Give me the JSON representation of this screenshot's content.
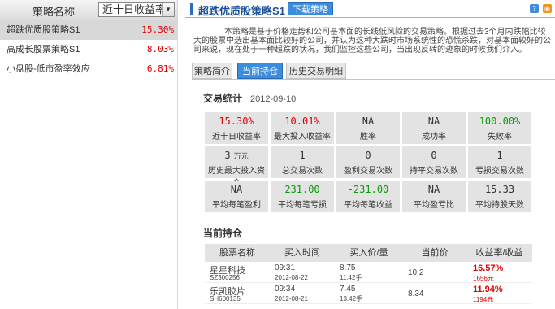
{
  "sidebar": {
    "header_name": "策略名称",
    "sort_select": "近十日收益率",
    "items": [
      {
        "label": "超跌优质股策略S1",
        "value": "15.30%"
      },
      {
        "label": "高成长股票策略S1",
        "value": "8.03%"
      },
      {
        "label": "小盘股-低市盈率效应",
        "value": "6.81%"
      }
    ]
  },
  "header": {
    "title": "超跌优质股策略S1",
    "download_label": "下载策略",
    "help_icon": "help-icon",
    "rss_icon": "rss-icon"
  },
  "description": "本策略是基于价格走势和公司基本面的长线低风险的交易策略。根据过去3个月内跌幅比较大的股票中选出基本面比较好的公司，并认为这种大跌时市场系统性的恐慌杀跌，对基本面较好的公司来说，现在处于一种超跌的状况，我们监控这些公司，当出现反转的迹象的时候我们介入。",
  "tabs": [
    "策略简介",
    "当前持仓",
    "历史交易明细"
  ],
  "stats": {
    "title": "交易统计",
    "date": "2012-09-10",
    "cells": [
      {
        "value": "15.30%",
        "label": "近十日收益率",
        "color": "red"
      },
      {
        "value": "10.01%",
        "label": "最大投入收益率",
        "color": "red"
      },
      {
        "value": "NA",
        "label": "胜率",
        "color": "black"
      },
      {
        "value": "NA",
        "label": "成功率",
        "color": "black"
      },
      {
        "value": "100.00%",
        "label": "失败率",
        "color": "green"
      },
      {
        "value": "3",
        "unit": "万元",
        "label": "历史最大投入资金",
        "color": "black"
      },
      {
        "value": "1",
        "label": "总交易次数",
        "color": "black"
      },
      {
        "value": "0",
        "label": "盈利交易次数",
        "color": "black"
      },
      {
        "value": "0",
        "label": "持平交易次数",
        "color": "black"
      },
      {
        "value": "1",
        "label": "亏损交易次数",
        "color": "black"
      },
      {
        "value": "NA",
        "label": "平均每笔盈利",
        "color": "black"
      },
      {
        "value": "231.00",
        "label": "平均每笔亏损",
        "color": "green"
      },
      {
        "value": "-231.00",
        "label": "平均每笔收益",
        "color": "green"
      },
      {
        "value": "NA",
        "label": "平均盈亏比",
        "color": "black"
      },
      {
        "value": "15.33",
        "label": "平均持股天数",
        "color": "black"
      }
    ]
  },
  "holdings": {
    "title": "当前持仓",
    "columns": [
      "股票名称",
      "买入时间",
      "买入价/量",
      "当前价",
      "收益率/收益"
    ],
    "rows": [
      {
        "name": "星星科技",
        "code": "SZ300256",
        "time": "09:31",
        "date": "2012-08-22",
        "price": "8.75",
        "qty": "11.42手",
        "current": "10.2",
        "rate": "16.57%",
        "gain": "1656元"
      },
      {
        "name": "乐凯胶片",
        "code": "SH600135",
        "time": "09:34",
        "date": "2012-08-21",
        "price": "7.45",
        "qty": "13.42手",
        "current": "8.34",
        "rate": "11.94%",
        "gain": "1194元"
      }
    ]
  }
}
